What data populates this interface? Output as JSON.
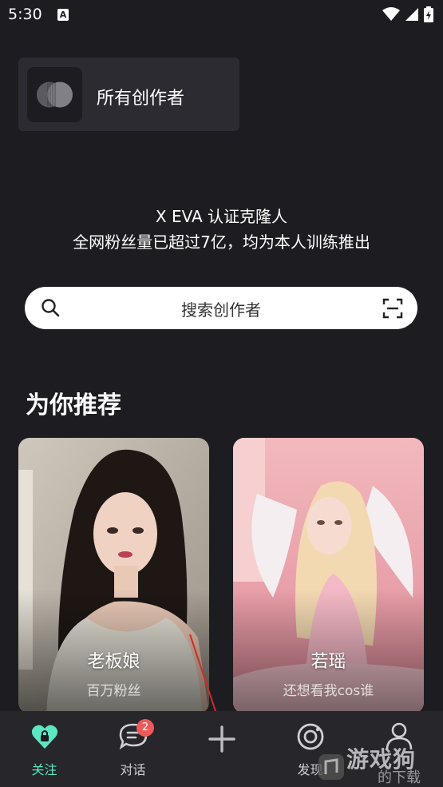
{
  "status_bar": {
    "time": "5:30",
    "notification_icon": "A"
  },
  "creators_card": {
    "label": "所有创作者"
  },
  "intro": {
    "line1": "X EVA 认证克隆人",
    "line2": "全网粉丝量已超过7亿，均为本人训练推出"
  },
  "search": {
    "placeholder": "搜索创作者"
  },
  "recommend": {
    "title": "为你推荐",
    "cards": [
      {
        "name": "老板娘",
        "subtitle": "百万粉丝"
      },
      {
        "name": "若瑶",
        "subtitle": "还想看我cos谁"
      }
    ]
  },
  "bottom_nav": {
    "items": [
      {
        "label": "关注",
        "icon": "heart-lock-icon",
        "active": true
      },
      {
        "label": "对话",
        "icon": "chat-icon",
        "badge": "2"
      },
      {
        "label": "",
        "icon": "plus-icon"
      },
      {
        "label": "发现",
        "icon": "discover-icon"
      },
      {
        "label": "",
        "icon": "profile-icon"
      }
    ]
  },
  "watermark": {
    "text": "游戏狗",
    "sub": "的下载"
  },
  "colors": {
    "background": "#1d1d21",
    "card": "#2b2b31",
    "accent": "#5ce6c2",
    "badge": "#ee5a5a"
  }
}
